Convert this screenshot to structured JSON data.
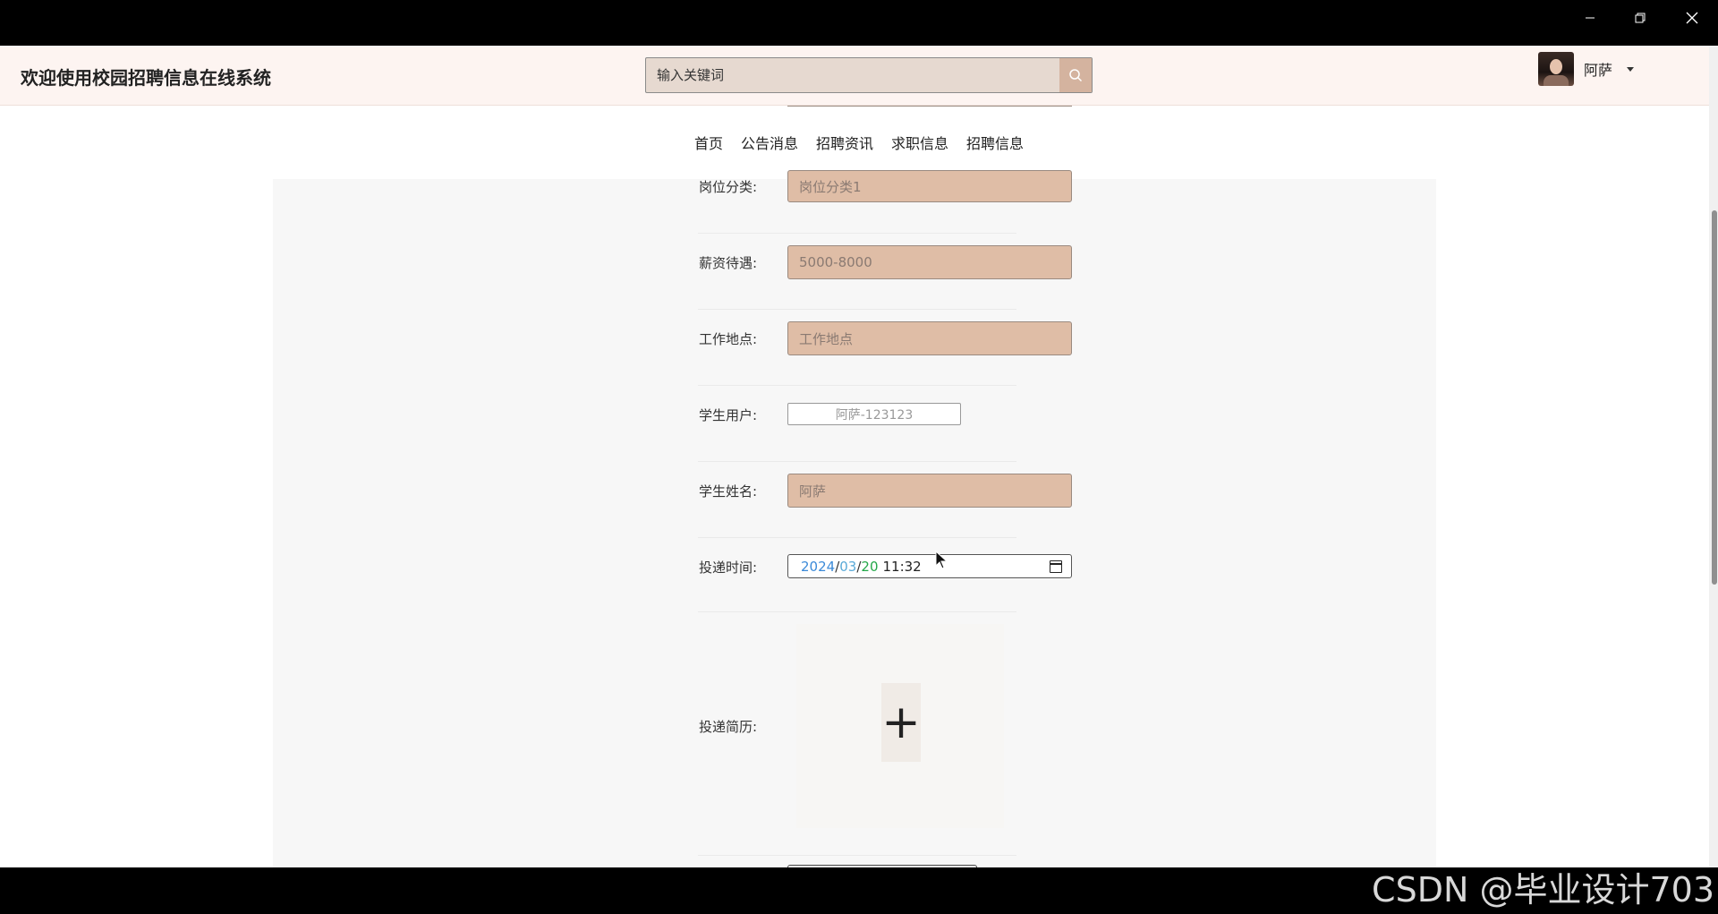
{
  "window": {
    "minimize_icon": "minimize-icon",
    "maximize_icon": "restore-icon",
    "close_icon": "close-icon"
  },
  "header": {
    "site_title": "欢迎使用校园招聘信息在线系统",
    "search": {
      "placeholder": "输入关键词",
      "button_icon": "search-icon"
    },
    "user": {
      "name": "阿萨",
      "dropdown_icon": "caret-down-icon"
    }
  },
  "nav": {
    "items": [
      {
        "label": "首页"
      },
      {
        "label": "公告消息"
      },
      {
        "label": "招聘资讯"
      },
      {
        "label": "求职信息"
      },
      {
        "label": "招聘信息"
      }
    ]
  },
  "form": {
    "job_category": {
      "label": "岗位分类:",
      "placeholder": "岗位分类1"
    },
    "salary": {
      "label": "薪资待遇:",
      "placeholder": "5000-8000"
    },
    "work_location": {
      "label": "工作地点:",
      "placeholder": "工作地点"
    },
    "student_user": {
      "label": "学生用户:",
      "value": "阿萨-123123"
    },
    "student_name": {
      "label": "学生姓名:",
      "placeholder": "阿萨"
    },
    "submit_time": {
      "label": "投递时间:",
      "year": "2024",
      "month": "03",
      "day": "20",
      "sep": "/",
      "time": "11:32",
      "icon": "calendar-icon"
    },
    "resume": {
      "label": "投递简历:",
      "upload_symbol": "+"
    }
  },
  "watermark": "CSDN @毕业设计703",
  "colors": {
    "header_bg": "#fdf4f1",
    "field_bg": "#dfbda6",
    "search_btn": "#d4b39f",
    "panel_bg": "#f7f7f7"
  }
}
